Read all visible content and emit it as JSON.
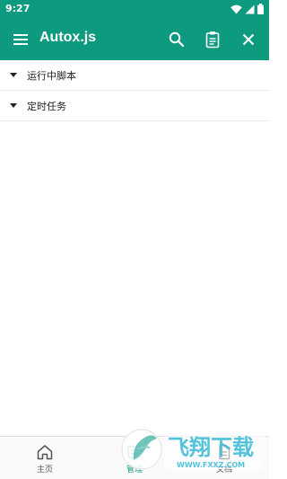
{
  "status_bar": {
    "time": "9:27"
  },
  "app_bar": {
    "title": "Autox.js",
    "icons": [
      "menu-icon",
      "search-icon",
      "clipboard-icon",
      "close-icon"
    ],
    "color": "#0e9a7f"
  },
  "groups": [
    {
      "label": "运行中脚本",
      "icon": "caret-down-icon"
    },
    {
      "label": "定时任务",
      "icon": "caret-down-icon"
    }
  ],
  "bottom_nav": {
    "items": [
      {
        "label": "主页",
        "icon": "home-icon",
        "active": false
      },
      {
        "label": "管理",
        "icon": "manage-icon",
        "active": true
      },
      {
        "label": "文档",
        "icon": "document-icon",
        "active": false
      }
    ]
  },
  "watermark": {
    "brand": "飞翔下载",
    "url": "WWW.FXXZ.COM"
  }
}
